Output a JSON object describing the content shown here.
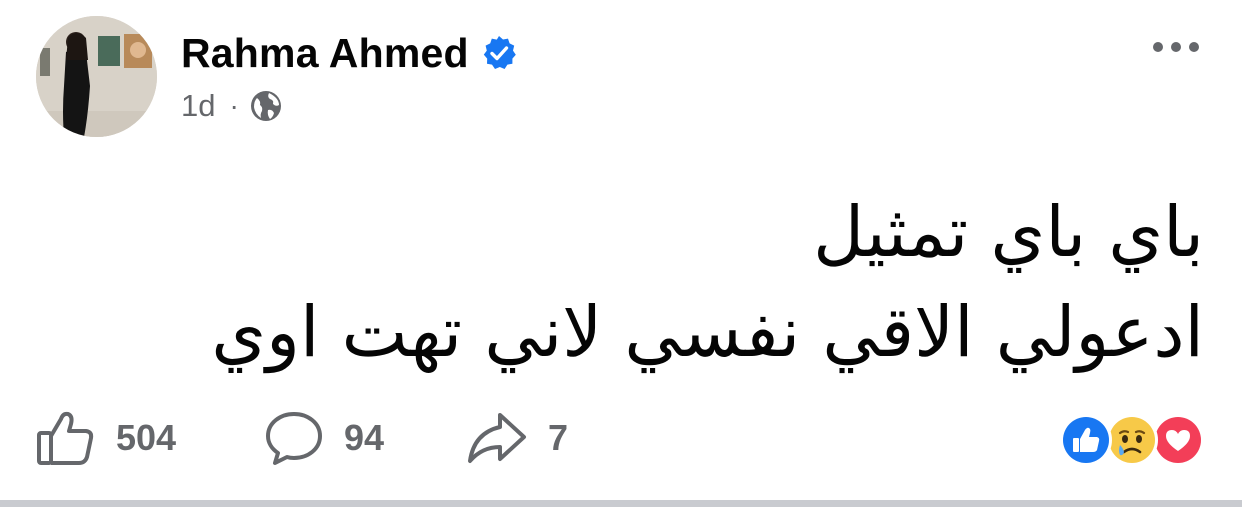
{
  "post": {
    "author": "Rahma Ahmed",
    "verified": true,
    "time": "1d",
    "separator": "·",
    "audience_icon": "globe-icon",
    "text_lines": [
      "باي باي تمثيل",
      "ادعولي الاقي نفسي لاني تهت اوي"
    ],
    "reaction_types": [
      "like",
      "sad",
      "love"
    ]
  },
  "actions": {
    "like_count": "504",
    "comment_count": "94",
    "share_count": "7"
  },
  "colors": {
    "text_primary": "#050505",
    "text_secondary": "#65676b",
    "verified_blue": "#1877f2",
    "like_blue": "#1877f2",
    "love_red": "#f33e58",
    "sad_yellow": "#f7c948"
  }
}
